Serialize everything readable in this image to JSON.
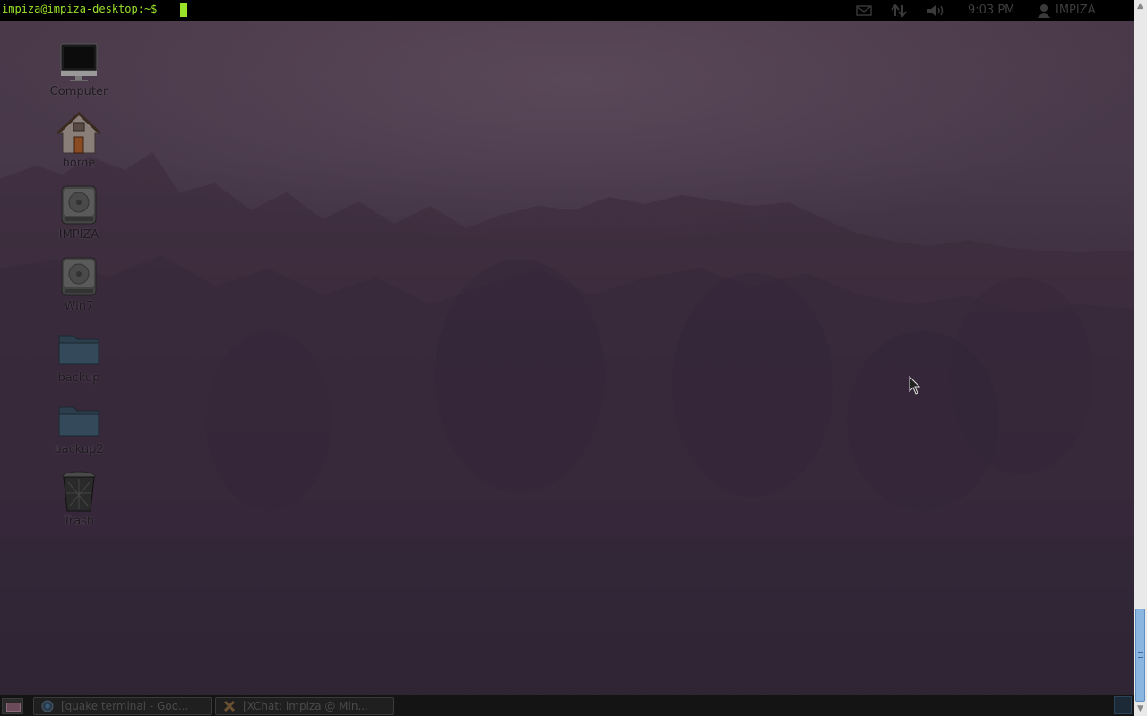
{
  "terminal": {
    "prompt": "impiza@impiza-desktop:~$"
  },
  "panel": {
    "indicators": [
      {
        "icon": "mail-icon"
      },
      {
        "icon": "network-icon"
      },
      {
        "icon": "volume-icon"
      }
    ],
    "clock": "9:03 PM",
    "user": {
      "icon": "user-icon",
      "name": "IMPIZA"
    }
  },
  "desktop": {
    "icons": [
      {
        "label": "Computer",
        "icon": "computer-icon"
      },
      {
        "label": "home",
        "icon": "home-icon"
      },
      {
        "label": "IMPIZA",
        "icon": "drive-icon"
      },
      {
        "label": "Win7",
        "icon": "drive-icon"
      },
      {
        "label": "backup",
        "icon": "folder-icon"
      },
      {
        "label": "backup2",
        "icon": "folder-icon"
      },
      {
        "label": "Trash",
        "icon": "trash-icon"
      }
    ]
  },
  "taskbar": {
    "tasks": [
      {
        "label": "[quake terminal - Goo...",
        "icon": "chrome-icon"
      },
      {
        "label": "[XChat: impiza @ Min...",
        "icon": "xchat-icon"
      }
    ]
  },
  "colors": {
    "prompt": "#9be22b",
    "panel_bg": "#000000",
    "wallpaper": "#3e2f40",
    "scroll_thumb": "#8ab6e0"
  }
}
